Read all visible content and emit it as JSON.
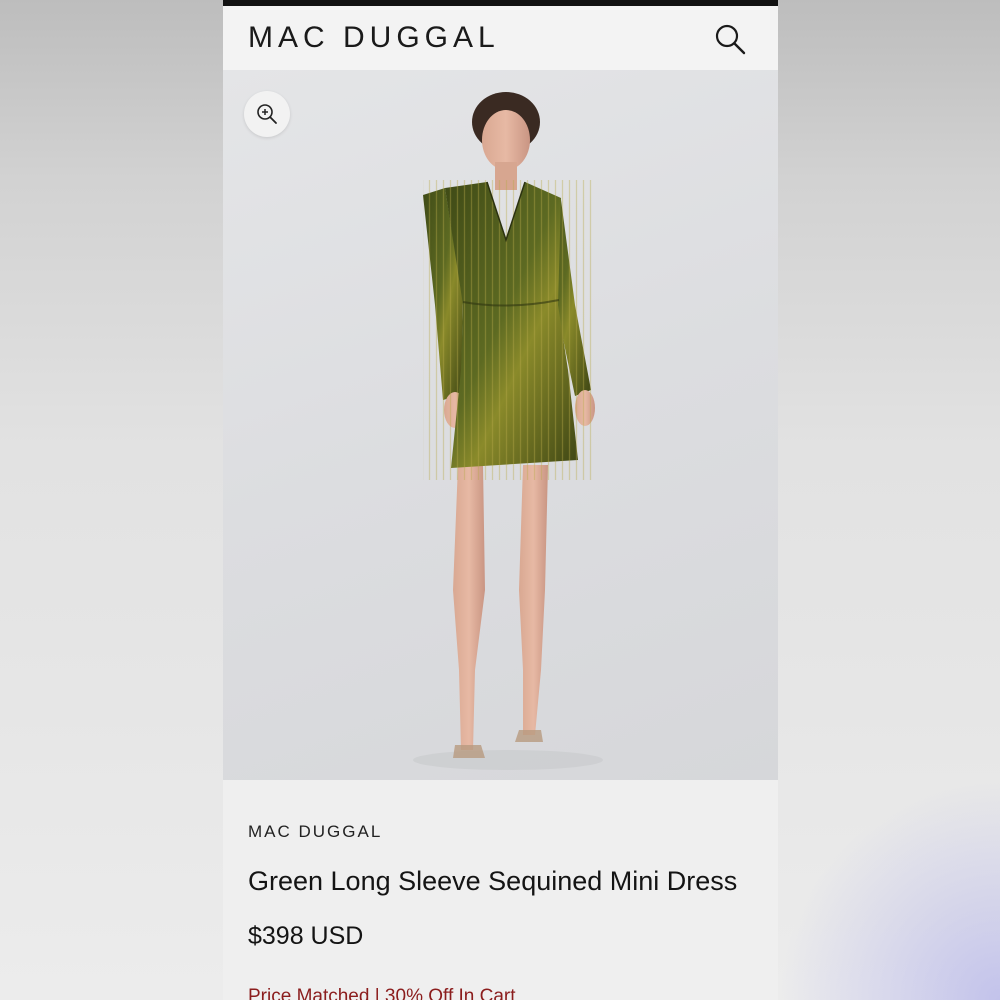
{
  "header": {
    "logo": "MAC DUGGAL",
    "search_icon": "search-icon"
  },
  "hero": {
    "zoom_icon": "zoom-in-icon",
    "dress_color": "#4e5a1e"
  },
  "product": {
    "brand": "MAC DUGGAL",
    "title": "Green Long Sleeve Sequined Mini Dress",
    "price": "$398 USD",
    "promo": "Price Matched | 30% Off In Cart"
  },
  "colors": {
    "topbar": "#111111",
    "promo": "#8b1d1d"
  }
}
